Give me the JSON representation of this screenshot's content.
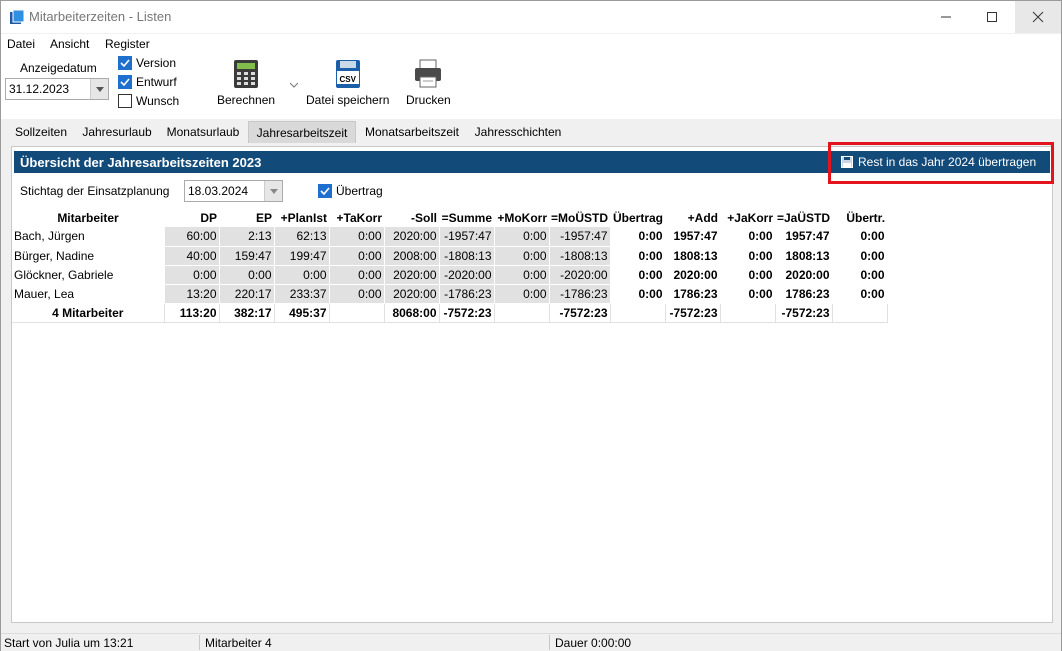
{
  "window": {
    "title": "Mitarbeiterzeiten - Listen"
  },
  "menu": [
    "Datei",
    "Ansicht",
    "Register"
  ],
  "toolbar": {
    "date_label": "Anzeigedatum",
    "date_value": "31.12.2023",
    "checkboxes": [
      {
        "label": "Version",
        "checked": true
      },
      {
        "label": "Entwurf",
        "checked": true
      },
      {
        "label": "Wunsch",
        "checked": false
      }
    ],
    "calc_label": "Berechnen",
    "save_label": "Datei speichern",
    "print_label": "Drucken",
    "csv_icon_text": "CSV"
  },
  "tabs": [
    {
      "label": "Sollzeiten",
      "active": false
    },
    {
      "label": "Jahresurlaub",
      "active": false
    },
    {
      "label": "Monatsurlaub",
      "active": false
    },
    {
      "label": "Jahresarbeitszeit",
      "active": true
    },
    {
      "label": "Monatsarbeitszeit",
      "active": false
    },
    {
      "label": "Jahresschichten",
      "active": false
    }
  ],
  "panel": {
    "title": "Übersicht der Jahresarbeitszeiten 2023",
    "transfer_label": "Rest in das Jahr 2024 übertragen",
    "stichtag_label": "Stichtag der Einsatzplanung",
    "stichtag_value": "18.03.2024",
    "uebertrag_label": "Übertrag",
    "uebertrag_checked": true
  },
  "table": {
    "columns": [
      "Mitarbeiter",
      "DP",
      "EP",
      "+PlanIst",
      "+TaKorr",
      "-Soll",
      "=Summe",
      "+MoKorr",
      "=MoÜSTD",
      "Übertrag",
      "+Add",
      "+JaKorr",
      "=JaÜSTD",
      "Übertr."
    ],
    "rows": [
      [
        "Bach, Jürgen",
        "60:00",
        "2:13",
        "62:13",
        "0:00",
        "2020:00",
        "-1957:47",
        "0:00",
        "-1957:47",
        "0:00",
        "1957:47",
        "0:00",
        "1957:47",
        "0:00"
      ],
      [
        "Bürger, Nadine",
        "40:00",
        "159:47",
        "199:47",
        "0:00",
        "2008:00",
        "-1808:13",
        "0:00",
        "-1808:13",
        "0:00",
        "1808:13",
        "0:00",
        "1808:13",
        "0:00"
      ],
      [
        "Glöckner, Gabriele",
        "0:00",
        "0:00",
        "0:00",
        "0:00",
        "2020:00",
        "-2020:00",
        "0:00",
        "-2020:00",
        "0:00",
        "2020:00",
        "0:00",
        "2020:00",
        "0:00"
      ],
      [
        "Mauer, Lea",
        "13:20",
        "220:17",
        "233:37",
        "0:00",
        "2020:00",
        "-1786:23",
        "0:00",
        "-1786:23",
        "0:00",
        "1786:23",
        "0:00",
        "1786:23",
        "0:00"
      ]
    ],
    "total": [
      "4 Mitarbeiter",
      "113:20",
      "382:17",
      "495:37",
      "",
      "8068:00",
      "-7572:23",
      "",
      "-7572:23",
      "",
      "-7572:23",
      "",
      "-7572:23",
      ""
    ]
  },
  "status": {
    "start": "Start von Julia um 13:21",
    "count": "Mitarbeiter 4",
    "duration": "Dauer 0:00:00"
  },
  "colors": {
    "header": "#124a7a",
    "highlight": "#e4141e",
    "accent": "#1f6fcf"
  }
}
